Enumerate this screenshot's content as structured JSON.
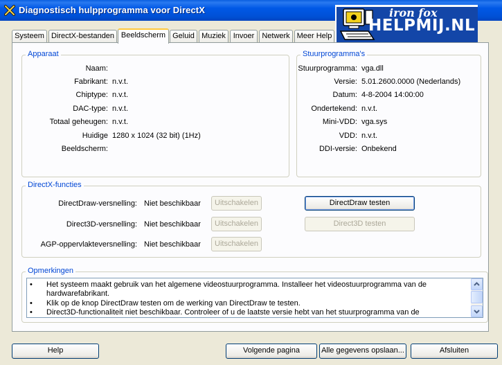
{
  "window": {
    "title": "Diagnostisch hulpprogramma voor DirectX"
  },
  "logo": {
    "line1": "iron fox",
    "line2": "HELPMIJ.NL"
  },
  "tabs": [
    {
      "label": "Systeem"
    },
    {
      "label": "DirectX-bestanden"
    },
    {
      "label": "Beeldscherm"
    },
    {
      "label": "Geluid"
    },
    {
      "label": "Muziek"
    },
    {
      "label": "Invoer"
    },
    {
      "label": "Netwerk"
    },
    {
      "label": "Meer Help"
    }
  ],
  "device": {
    "legend": "Apparaat",
    "rows": [
      {
        "label": "Naam:",
        "value": ""
      },
      {
        "label": "Fabrikant:",
        "value": "n.v.t."
      },
      {
        "label": "Chiptype:",
        "value": "n.v.t."
      },
      {
        "label": "DAC-type:",
        "value": "n.v.t."
      },
      {
        "label": "Totaal geheugen:",
        "value": "n.v.t."
      },
      {
        "label": "Huidige",
        "value": "1280 x 1024 (32 bit) (1Hz)"
      },
      {
        "label": "Beeldscherm:",
        "value": ""
      }
    ]
  },
  "driver": {
    "legend": "Stuurprogramma's",
    "rows": [
      {
        "label": "Stuurprogramma:",
        "value": "vga.dll"
      },
      {
        "label": "Versie:",
        "value": "5.01.2600.0000 (Nederlands)"
      },
      {
        "label": "Datum:",
        "value": "4-8-2004 14:00:00"
      },
      {
        "label": "Ondertekend:",
        "value": "n.v.t."
      },
      {
        "label": "Mini-VDD:",
        "value": "vga.sys"
      },
      {
        "label": "VDD:",
        "value": "n.v.t."
      },
      {
        "label": "DDI-versie:",
        "value": "Onbekend"
      }
    ]
  },
  "directx": {
    "legend": "DirectX-functies",
    "rows": [
      {
        "label": "DirectDraw-versnelling:",
        "value": "Niet beschikbaar",
        "disable_button": "Uitschakelen",
        "test_button": "DirectDraw testen"
      },
      {
        "label": "Direct3D-versnelling:",
        "value": "Niet beschikbaar",
        "disable_button": "Uitschakelen",
        "test_button": "Direct3D testen"
      },
      {
        "label": "AGP-oppervlakteversnelling:",
        "value": "Niet beschikbaar",
        "disable_button": "Uitschakelen"
      }
    ]
  },
  "notes": {
    "legend": "Opmerkingen",
    "items": [
      "Het systeem maakt gebruik van het algemene videostuurprogramma. Installeer het videostuurprogramma van de hardwarefabrikant.",
      "Klik op de knop DirectDraw testen om de werking van DirectDraw te testen.",
      "Direct3D-functionaliteit niet beschikbaar. Controleer of u de laatste versie hebt van het stuurprogramma van de"
    ]
  },
  "footer": {
    "help": "Help",
    "next": "Volgende pagina",
    "save": "Alle gegevens opslaan...",
    "close": "Afsluiten"
  }
}
